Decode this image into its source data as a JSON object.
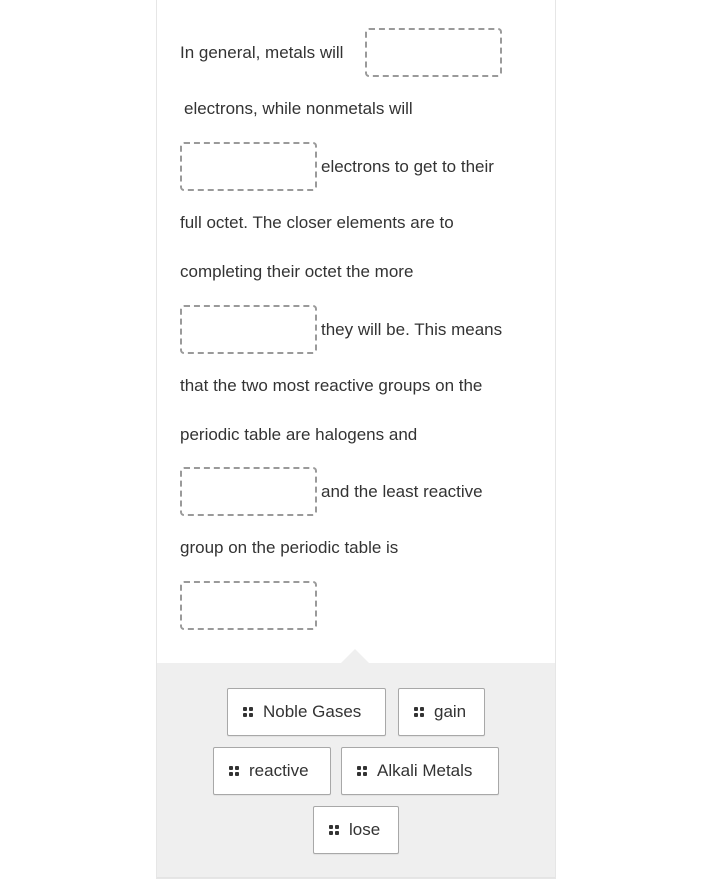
{
  "passage": {
    "lines": [
      "In general, metals will",
      "electrons, while nonmetals will",
      "electrons to get to their",
      "full octet. The closer elements are to",
      "completing their octet the more",
      "they will be. This means",
      "that the two most reactive groups on the",
      "periodic table are halogens and",
      "and the least reactive",
      "group on the periodic table is"
    ],
    "blanks": [
      {
        "id": 1,
        "value": ""
      },
      {
        "id": 2,
        "value": ""
      },
      {
        "id": 3,
        "value": ""
      },
      {
        "id": 4,
        "value": ""
      },
      {
        "id": 5,
        "value": ""
      }
    ]
  },
  "tray": {
    "tokens": [
      {
        "label": "Noble Gases",
        "icon": "drag-grip-icon"
      },
      {
        "label": "gain",
        "icon": "drag-grip-icon"
      },
      {
        "label": "reactive",
        "icon": "drag-grip-icon"
      },
      {
        "label": "Alkali Metals",
        "icon": "drag-grip-icon"
      },
      {
        "label": "lose",
        "icon": "drag-grip-icon"
      }
    ]
  },
  "colors": {
    "text": "#333333",
    "dashed_border": "#9a9a9a",
    "tray_background": "#efefef",
    "token_border": "#a8a8a8"
  }
}
